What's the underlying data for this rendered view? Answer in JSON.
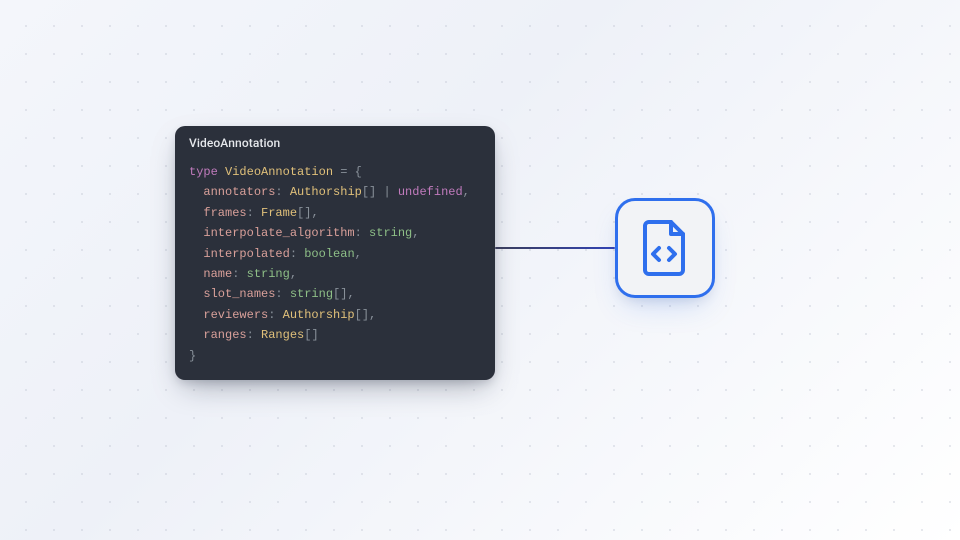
{
  "card": {
    "title": "VideoAnnotation",
    "type_keyword": "type",
    "type_name": "VideoAnnotation",
    "fields": [
      {
        "name": "annotators",
        "type": "Authorship[] | undefined"
      },
      {
        "name": "frames",
        "type": "Frame[]"
      },
      {
        "name": "interpolate_algorithm",
        "type": "string"
      },
      {
        "name": "interpolated",
        "type": "boolean"
      },
      {
        "name": "name",
        "type": "string"
      },
      {
        "name": "slot_names",
        "type": "string[]"
      },
      {
        "name": "reviewers",
        "type": "Authorship[]"
      },
      {
        "name": "ranges",
        "type": "Ranges[]"
      }
    ]
  },
  "colors": {
    "card_bg": "#2b303b",
    "accent_blue": "#2f6fed",
    "connector_start": "#3a3d5a",
    "connector_end": "#3344b5"
  },
  "icon": {
    "name": "code-file-icon"
  }
}
